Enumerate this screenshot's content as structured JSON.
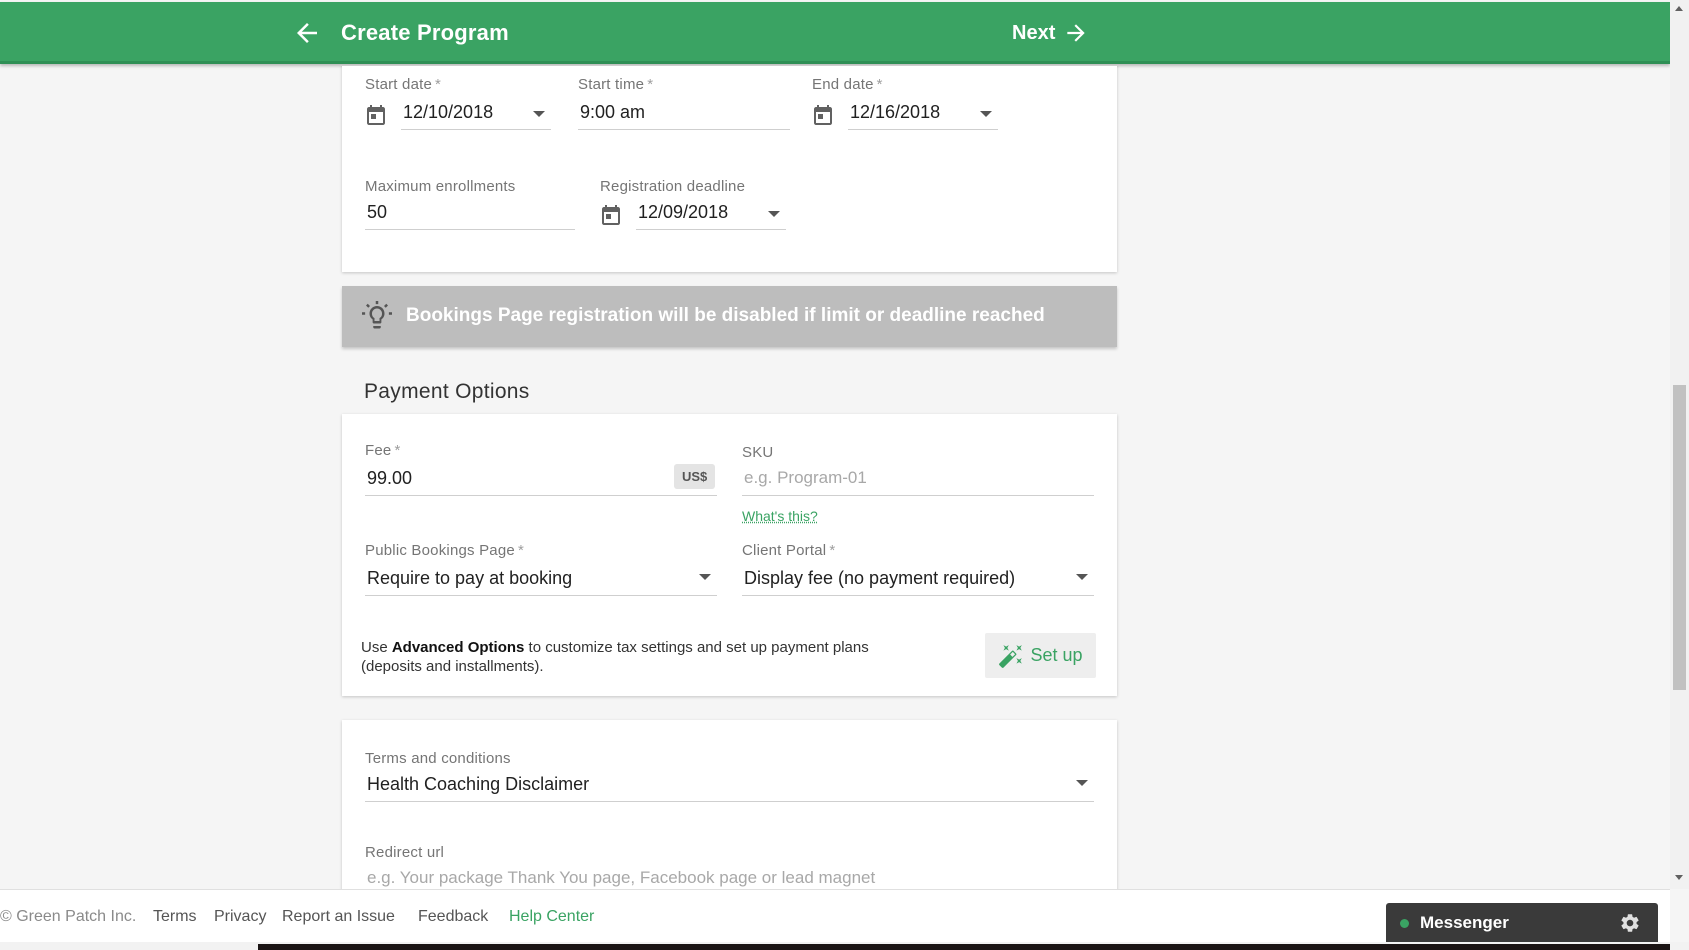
{
  "app_bar": {
    "title": "Create Program",
    "next_label": "Next",
    "color": "#3aa363"
  },
  "schedule": {
    "start_date": {
      "label": "Start date",
      "required": "*",
      "value": "12/10/2018"
    },
    "start_time": {
      "label": "Start time",
      "required": "*",
      "value": "9:00 am"
    },
    "end_date": {
      "label": "End date",
      "required": "*",
      "value": "12/16/2018"
    },
    "max_enrollments": {
      "label": "Maximum enrollments",
      "value": "50"
    },
    "registration_deadline": {
      "label": "Registration deadline",
      "value": "12/09/2018"
    }
  },
  "banner": {
    "text": "Bookings Page registration will be disabled if limit or deadline reached",
    "icon": "lightbulb-icon"
  },
  "payment": {
    "section_title": "Payment Options",
    "fee": {
      "label": "Fee",
      "required": "*",
      "value": "99.00",
      "currency": "US$"
    },
    "sku": {
      "label": "SKU",
      "placeholder": "e.g. Program-01",
      "help_link": "What's this?"
    },
    "public_bookings": {
      "label": "Public Bookings Page",
      "required": "*",
      "value": "Require to pay at booking"
    },
    "client_portal": {
      "label": "Client Portal",
      "required": "*",
      "value": "Display fee (no payment required)"
    },
    "advanced": {
      "prefix": "Use ",
      "bold": "Advanced Options",
      "suffix": " to customize tax settings and set up payment plans (deposits and installments)."
    },
    "setup_label": "Set up"
  },
  "terms": {
    "terms_label": "Terms and conditions",
    "terms_value": "Health Coaching Disclaimer",
    "redirect_label": "Redirect url",
    "redirect_placeholder": "e.g. Your package Thank You page, Facebook page or lead magnet"
  },
  "footer": {
    "copyright": "© Green Patch Inc.",
    "links": [
      "Terms",
      "Privacy",
      "Report an Issue",
      "Feedback"
    ],
    "help": "Help Center",
    "messenger": "Messenger"
  }
}
